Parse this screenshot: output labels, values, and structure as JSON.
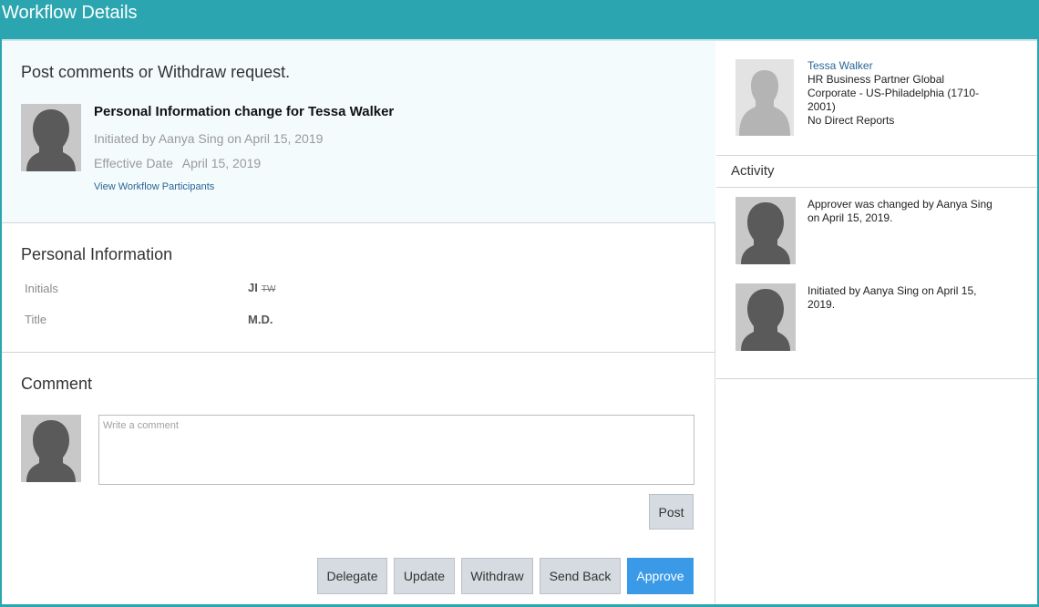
{
  "window": {
    "title": "Workflow Details"
  },
  "request": {
    "heading": "Post comments or Withdraw request.",
    "title": "Personal Information change for Tessa Walker",
    "initiated": "Initiated by Aanya Sing on April 15, 2019",
    "effective_label": "Effective Date",
    "effective_date": "April 15, 2019",
    "participants_link": "View Workflow Participants"
  },
  "personal_info": {
    "heading": "Personal Information",
    "rows": [
      {
        "label": "Initials",
        "value": "JI",
        "old_value": "TW"
      },
      {
        "label": "Title",
        "value": "M.D."
      }
    ]
  },
  "comment": {
    "heading": "Comment",
    "placeholder": "Write a comment",
    "value": "",
    "post_label": "Post"
  },
  "actions": {
    "delegate": "Delegate",
    "update": "Update",
    "withdraw": "Withdraw",
    "send_back": "Send Back",
    "approve": "Approve"
  },
  "subject": {
    "name": "Tessa Walker",
    "role_line1": "HR Business Partner Global",
    "role_line2": "Corporate - US-Philadelphia (1710-",
    "role_line3": "2001)",
    "reports": "No Direct Reports"
  },
  "activity": {
    "heading": "Activity",
    "items": [
      {
        "line1": "Approver was changed by Aanya Sing",
        "line2": "on April 15, 2019."
      },
      {
        "line1": "Initiated by Aanya Sing on April 15,",
        "line2": "2019."
      }
    ]
  },
  "colors": {
    "titlebar": "#2ba6b0",
    "primary_button": "#3b9ae8",
    "link": "#2a6496"
  },
  "icons": {
    "avatar": "person-silhouette-icon"
  }
}
